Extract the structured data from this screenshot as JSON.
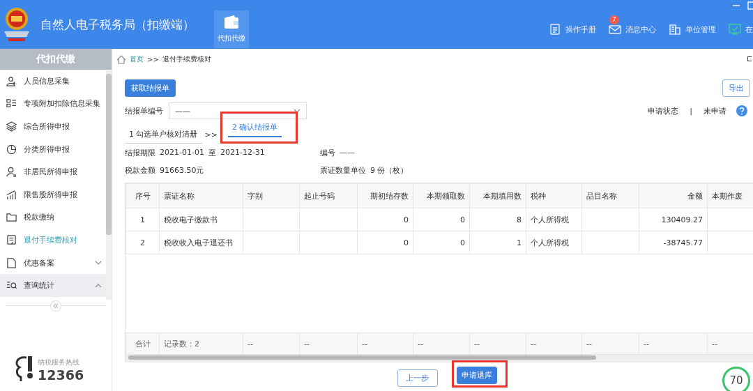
{
  "header": {
    "title": "自然人电子税务局（扣缴端）",
    "tabs": [
      {
        "label": "代扣代缴",
        "selected": true
      }
    ],
    "actions": [
      {
        "label": "操作手册"
      },
      {
        "label": "消息中心",
        "badge": "7"
      },
      {
        "label": "单位管理"
      },
      {
        "label": "在"
      }
    ]
  },
  "sidebar": {
    "title": "代扣代缴",
    "items": [
      {
        "label": "人员信息采集",
        "selected": false
      },
      {
        "label": "专项附加扣除信息采集",
        "selected": false
      },
      {
        "label": "综合所得申报",
        "selected": false
      },
      {
        "label": "分类所得申报",
        "selected": false
      },
      {
        "label": "非居民所得申报",
        "selected": false
      },
      {
        "label": "限售股所得申报",
        "selected": false
      },
      {
        "label": "税款缴纳",
        "selected": false
      },
      {
        "label": "退付手续费核对",
        "selected": true
      },
      {
        "label": "优惠备案",
        "selected": false,
        "expanded": false
      },
      {
        "label": "查询统计",
        "selected": false,
        "expanded": true
      }
    ],
    "hotline": {
      "label": "纳税服务热线",
      "number": "12366"
    }
  },
  "breadcrumb": {
    "home": "首页",
    "separator": ">>",
    "current": "退付手续费核对"
  },
  "fetch_button": "获取结报单",
  "export_button": "导出",
  "report_no": {
    "label": "结报单编号",
    "value": "——"
  },
  "status": {
    "label": "申请状态",
    "separator": "|",
    "value": "未申请"
  },
  "steps": [
    {
      "label": "1 勾选单户核对清册",
      "selected": false,
      "highlighted": false
    },
    {
      "label": "2 确认结报单",
      "selected": true,
      "highlighted": true
    }
  ],
  "step_separator": ">>",
  "info": {
    "period": {
      "label": "结报期限",
      "start": "2021-01-01",
      "to": "至",
      "end": "2021-12-31"
    },
    "number": {
      "label": "编号",
      "value": "——"
    },
    "tax_amount": {
      "label": "税款金额",
      "value": "91663.50元"
    },
    "ticket_count": {
      "label": "票证数量单位",
      "value": "9 份（枚）"
    }
  },
  "table": {
    "columns": [
      "序号",
      "票证名称",
      "字别",
      "起止号码",
      "期初结存数",
      "本期领取数",
      "本期填用数",
      "税种",
      "品目名称",
      "金额",
      "本期作废"
    ],
    "rows": [
      [
        "1",
        "税收电子缴款书",
        "",
        "",
        "0",
        "0",
        "8",
        "个人所得税",
        "",
        "130409.27",
        ""
      ],
      [
        "2",
        "税收收入电子退还书",
        "",
        "",
        "0",
        "0",
        "1",
        "个人所得税",
        "",
        "-38745.77",
        ""
      ]
    ],
    "footer": [
      "合计",
      "记录数：2",
      "--",
      "--",
      "--",
      "--",
      "--",
      "--",
      "--",
      "--",
      "--"
    ]
  },
  "buttons": [
    {
      "label": "上一步",
      "kind": "secondary",
      "highlighted": false
    },
    {
      "label": "申请退库",
      "kind": "primary",
      "highlighted": true
    }
  ],
  "gauge": {
    "text": "70"
  }
}
